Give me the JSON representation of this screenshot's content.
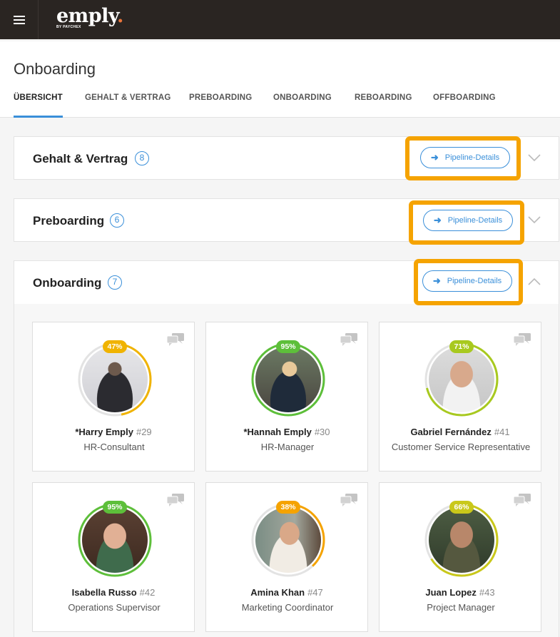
{
  "app": {
    "logo_text": "emply",
    "logo_dot": ".",
    "logo_sub": "BY PAYCHEX",
    "page_title": "Onboarding"
  },
  "tabs": [
    {
      "label": "ÜBERSICHT",
      "active": true
    },
    {
      "label": "GEHALT & VERTRAG",
      "active": false
    },
    {
      "label": "PREBOARDING",
      "active": false
    },
    {
      "label": "ONBOARDING",
      "active": false
    },
    {
      "label": "REBOARDING",
      "active": false
    },
    {
      "label": "OFFBOARDING",
      "active": false
    }
  ],
  "sections": [
    {
      "title": "Gehalt & Vertrag",
      "count": "8",
      "button": "Pipeline-Details",
      "expanded": false
    },
    {
      "title": "Preboarding",
      "count": "6",
      "button": "Pipeline-Details",
      "expanded": false
    },
    {
      "title": "Onboarding",
      "count": "7",
      "button": "Pipeline-Details",
      "expanded": true
    }
  ],
  "cards": [
    {
      "name": "*Harry Emply",
      "number": "#29",
      "role": "HR-Consultant",
      "percent": "47%",
      "progress": 0.47,
      "color": "#f0b300"
    },
    {
      "name": "*Hannah Emply",
      "number": "#30",
      "role": "HR-Manager",
      "percent": "95%",
      "progress": 0.95,
      "color": "#5dbf3a"
    },
    {
      "name": "Gabriel Fernández",
      "number": "#41",
      "role": "Customer Service Representative",
      "percent": "71%",
      "progress": 0.71,
      "color": "#a8c91f"
    },
    {
      "name": "Isabella Russo",
      "number": "#42",
      "role": "Operations Supervisor",
      "percent": "95%",
      "progress": 0.95,
      "color": "#5dbf3a"
    },
    {
      "name": "Amina Khan",
      "number": "#47",
      "role": "Marketing Coordinator",
      "percent": "38%",
      "progress": 0.38,
      "color": "#f5a300"
    },
    {
      "name": "Juan Lopez",
      "number": "#43",
      "role": "Project Manager",
      "percent": "66%",
      "progress": 0.66,
      "color": "#c9c81a"
    }
  ],
  "colors": {
    "accent": "#3a8fd9",
    "highlight": "#f5a300",
    "topbar": "#2a2522"
  }
}
